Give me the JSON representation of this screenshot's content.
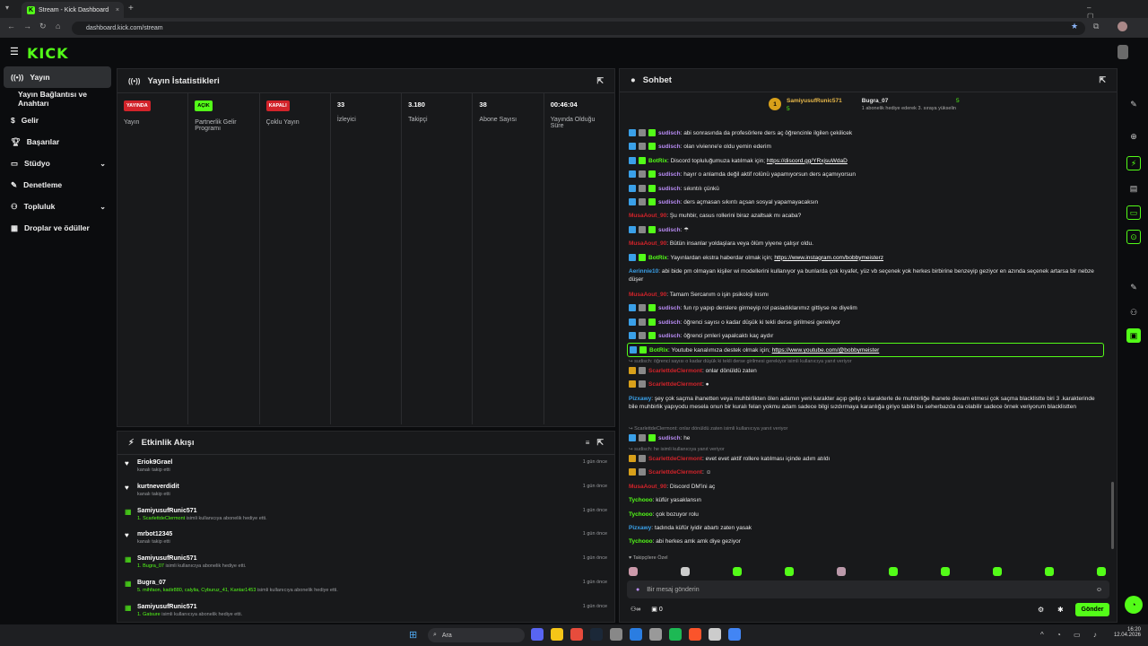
{
  "browser": {
    "tab_title": "Stream - Kick Dashboard",
    "url": "dashboard.kick.com/stream"
  },
  "brand": {
    "logo": "KICK",
    "accent": "#53fc18"
  },
  "sidebar": {
    "items": [
      {
        "label": "Yayın",
        "icon": "broadcast-icon",
        "active": true
      },
      {
        "label": "Yayın Bağlantısı ve Anahtarı",
        "icon": ""
      },
      {
        "label": "Gelir",
        "icon": "coins-icon"
      },
      {
        "label": "Başarılar",
        "icon": "trophy-icon"
      },
      {
        "label": "Stüdyo",
        "icon": "studio-icon",
        "expandable": true
      },
      {
        "label": "Denetleme",
        "icon": "wrench-icon"
      },
      {
        "label": "Topluluk",
        "icon": "community-icon",
        "expandable": true
      },
      {
        "label": "Droplar ve ödüller",
        "icon": "gift-icon"
      }
    ]
  },
  "stats": {
    "title": "Yayın İstatistikleri",
    "cells": [
      {
        "badge": "YAYINDA",
        "badge_color": "#d2232a",
        "label": "Yayın"
      },
      {
        "badge": "AÇIK",
        "badge_color": "#53fc18",
        "label": "Partnerlik Gelir Programı"
      },
      {
        "badge": "KAPALI",
        "badge_color": "#d2232a",
        "label": "Çoklu Yayın"
      },
      {
        "value": "33",
        "label": "İzleyici"
      },
      {
        "value": "3.180",
        "label": "Takipçi"
      },
      {
        "value": "38",
        "label": "Abone Sayısı"
      },
      {
        "value": "00:46:04",
        "label": "Yayında Olduğu Süre"
      }
    ]
  },
  "activity": {
    "title": "Etkinlik Akışı",
    "items": [
      {
        "icon": "heart-icon",
        "name": "Eriok9Grael",
        "sub": "kanalı takip etti",
        "time": "1 gün önce"
      },
      {
        "icon": "heart-icon",
        "name": "kurtneverdidit",
        "sub": "kanalı takip etti",
        "time": "1 gün önce"
      },
      {
        "icon": "gift-icon",
        "name": "SamiyusufRunic571",
        "sub_hl": "1. ScarlettdeClermont",
        "sub": " isimli kullanıcıya abonelik hediye etti.",
        "time": "1 gün önce"
      },
      {
        "icon": "heart-icon",
        "name": "mrbot12345",
        "sub": "kanalı takip etti",
        "time": "1 gün önce"
      },
      {
        "icon": "gift-icon",
        "name": "SamiyusufRunic571",
        "sub_hl": "1. Bugra_07",
        "sub": " isimli kullanıcıya abonelik hediye etti.",
        "time": "1 gün önce"
      },
      {
        "icon": "gift-icon",
        "name": "Bugra_07",
        "sub_hl": "5. mihfaon, kadir880, calylia, Cyburuz_41, Kantar1453",
        "sub": " isimli kullanıcıya abonelik hediye etti.",
        "time": "1 gün önce"
      },
      {
        "icon": "gift-icon",
        "name": "SamiyusufRunic571",
        "sub_hl": "1. Gatsure",
        "sub": " isimli kullanıcıya abonelik hediye etti.",
        "time": "1 gün önce"
      }
    ]
  },
  "chat": {
    "title": "Sohbet",
    "leader1": {
      "rank": "1",
      "name": "SamiyusufRunic571",
      "count": "5"
    },
    "leader2": {
      "name": "Bugra_07",
      "count": "5",
      "note": "1 abonelik hediye ederek 3. sıraya yükselin"
    },
    "messages": [
      {
        "t": "msg",
        "badges": [
          "bb",
          "bgr",
          "bg"
        ],
        "user": "sudisch",
        "color": "#b98cf5",
        "text": "abi sonrasında da profesörlere ders aç öğrencinle ilgilen çekilicek"
      },
      {
        "t": "msg",
        "badges": [
          "bb",
          "bgr",
          "bg"
        ],
        "user": "sudisch",
        "color": "#b98cf5",
        "text": "olan vivienne'e oldu yemin ederim"
      },
      {
        "t": "msg",
        "badges": [
          "bb",
          "bg"
        ],
        "user": "BotRix",
        "color": "#53fc18",
        "text": "Discord topluluğumuza katılmak için; ",
        "link": "https://discord.gg/YRxjsuWdaD"
      },
      {
        "t": "msg",
        "badges": [
          "bb",
          "bgr",
          "bg"
        ],
        "user": "sudisch",
        "color": "#b98cf5",
        "text": "hayır o anlamda değil aktif rolünü yapamıyorsun ders açamıyorsun"
      },
      {
        "t": "msg",
        "badges": [
          "bb",
          "bgr",
          "bg"
        ],
        "user": "sudisch",
        "color": "#b98cf5",
        "text": "sıkıntılı çünkü"
      },
      {
        "t": "msg",
        "badges": [
          "bb",
          "bgr",
          "bg"
        ],
        "user": "sudisch",
        "color": "#b98cf5",
        "text": "ders açmasan sıkıntı açsan sosyal yapamayacaksın"
      },
      {
        "t": "msg",
        "badges": [],
        "user": "MusaAout_90",
        "color": "#d2232a",
        "text": "Şu muhbir, casus rollerini biraz azaltsak mı acaba?"
      },
      {
        "t": "msg",
        "badges": [
          "bb",
          "bgr",
          "bg"
        ],
        "user": "sudisch",
        "color": "#b98cf5",
        "text": "☂"
      },
      {
        "t": "msg",
        "badges": [],
        "user": "MusaAout_90",
        "color": "#d2232a",
        "text": "Bütün insanlar yoldaşlara veya ölüm yiyene çalışır oldu."
      },
      {
        "t": "msg",
        "badges": [
          "bb",
          "bg"
        ],
        "user": "BotRix",
        "color": "#53fc18",
        "text": "Yayınlardan ekstra haberdar olmak için; ",
        "link": "https://www.instagram.com/bobbymeisterz"
      },
      {
        "t": "msg2",
        "badges": [],
        "user": "Aerinnie10",
        "color": "#3aa0e8",
        "text": "abi bide pm olmayan kişiler wi modellerini kullanıyor ya bunlarda çok kıyafet, yüz vb seçenek yok herkes birbirine benzeyip geziyor en azında seçenek artarsa bir nebze düşer"
      },
      {
        "t": "msg",
        "badges": [],
        "user": "MusaAout_90",
        "color": "#d2232a",
        "text": "Tamam Sercanım o işin psikoloji kısmı"
      },
      {
        "t": "msg",
        "badges": [
          "bb",
          "bgr",
          "bg"
        ],
        "user": "sudisch",
        "color": "#b98cf5",
        "text": "fun rp yapıp derslere girmeyip rol pasiadıklarımız gittiyse ne diyelim"
      },
      {
        "t": "msg",
        "badges": [
          "bb",
          "bgr",
          "bg"
        ],
        "user": "sudisch",
        "color": "#b98cf5",
        "text": "öğrenci sayısı o kadar düşük ki tekli derse girilmesi gerekiyor"
      },
      {
        "t": "msg",
        "badges": [
          "bb",
          "bgr",
          "bg"
        ],
        "user": "sudisch",
        "color": "#b98cf5",
        "text": "öğrenci pmleri yapalcaktı kaç aydır"
      },
      {
        "t": "hl",
        "badges": [
          "bb",
          "bg"
        ],
        "user": "BotRix",
        "color": "#53fc18",
        "text": "Youtube kanalımıza destek olmak için; ",
        "link": "https://www.youtube.com/@bobbymeister"
      },
      {
        "t": "reply",
        "text": "sudisch: öğrenci sayısı o kadar düşük ki tekli derse girilmesi gerekiyor isimli kullanıcıya yanıt veriyor"
      },
      {
        "t": "msg",
        "badges": [
          "bgold",
          "bgr"
        ],
        "user": "ScarlettdeClermont",
        "color": "#d2232a",
        "text": "onlar dönüldü zaten"
      },
      {
        "t": "msg",
        "badges": [
          "bgold",
          "bgr"
        ],
        "user": "ScarlettdeClermont",
        "color": "#d2232a",
        "text": "●"
      },
      {
        "t": "msg3",
        "badges": [],
        "user": "Pizxawy",
        "color": "#3aa0e8",
        "text": "şey çok saçma ihanetten veya muhbirlikten ölen adamın yeni karakter açıp gelip o karakterle de muhbirliğe ihanete devam etmesi çok saçma blacklistte biri 3 .karakterinde bile muhbirlik yapıyodu mesela onun bir kuralı felan yokmu adam sadece bilgi sızdırmaya karanlığa giriyo tabiki bu seherbazda da olabilir sadece örnek veriyorum blacklistten"
      },
      {
        "t": "reply",
        "text": "ScarlettdeClermont: onlar dönüldü zaten isimli kullanıcıya yanıt veriyor"
      },
      {
        "t": "msg",
        "badges": [
          "bb",
          "bgr",
          "bg"
        ],
        "user": "sudisch",
        "color": "#b98cf5",
        "text": "he"
      },
      {
        "t": "reply",
        "text": "sudisch: he isimli kullanıcıya yanıt veriyor"
      },
      {
        "t": "msg",
        "badges": [
          "bgold",
          "bgr"
        ],
        "user": "ScarlettdeClermont",
        "color": "#d2232a",
        "text": "evet evet aktif rollere katılması içinde adım atıldı"
      },
      {
        "t": "msg",
        "badges": [
          "bgold",
          "bgr"
        ],
        "user": "ScarlettdeClermont",
        "color": "#d2232a",
        "text": "☺"
      },
      {
        "t": "msg",
        "badges": [],
        "user": "MusaAout_90",
        "color": "#d2232a",
        "text": "Discord DM'ini aç"
      },
      {
        "t": "msg",
        "badges": [],
        "user": "Tychooo",
        "color": "#53fc18",
        "text": "küfür yasaklansın"
      },
      {
        "t": "msg",
        "badges": [],
        "user": "Tychooo",
        "color": "#53fc18",
        "text": "çok bozuyor rolu"
      },
      {
        "t": "msg",
        "badges": [],
        "user": "Pizxawy",
        "color": "#3aa0e8",
        "text": "tadında küfür iyidir abartı zaten yasak"
      },
      {
        "t": "msg",
        "badges": [],
        "user": "Tychooo",
        "color": "#53fc18",
        "text": "abi herkes amk amk diye geziyor"
      }
    ],
    "followers_label": "Takipçilere Özel",
    "input_placeholder": "Bir mesaj gönderin",
    "send_label": "Gönder",
    "count_left": "0"
  },
  "taskbar": {
    "search": "Ara",
    "time": "16:20",
    "date": "12.04.2026"
  }
}
